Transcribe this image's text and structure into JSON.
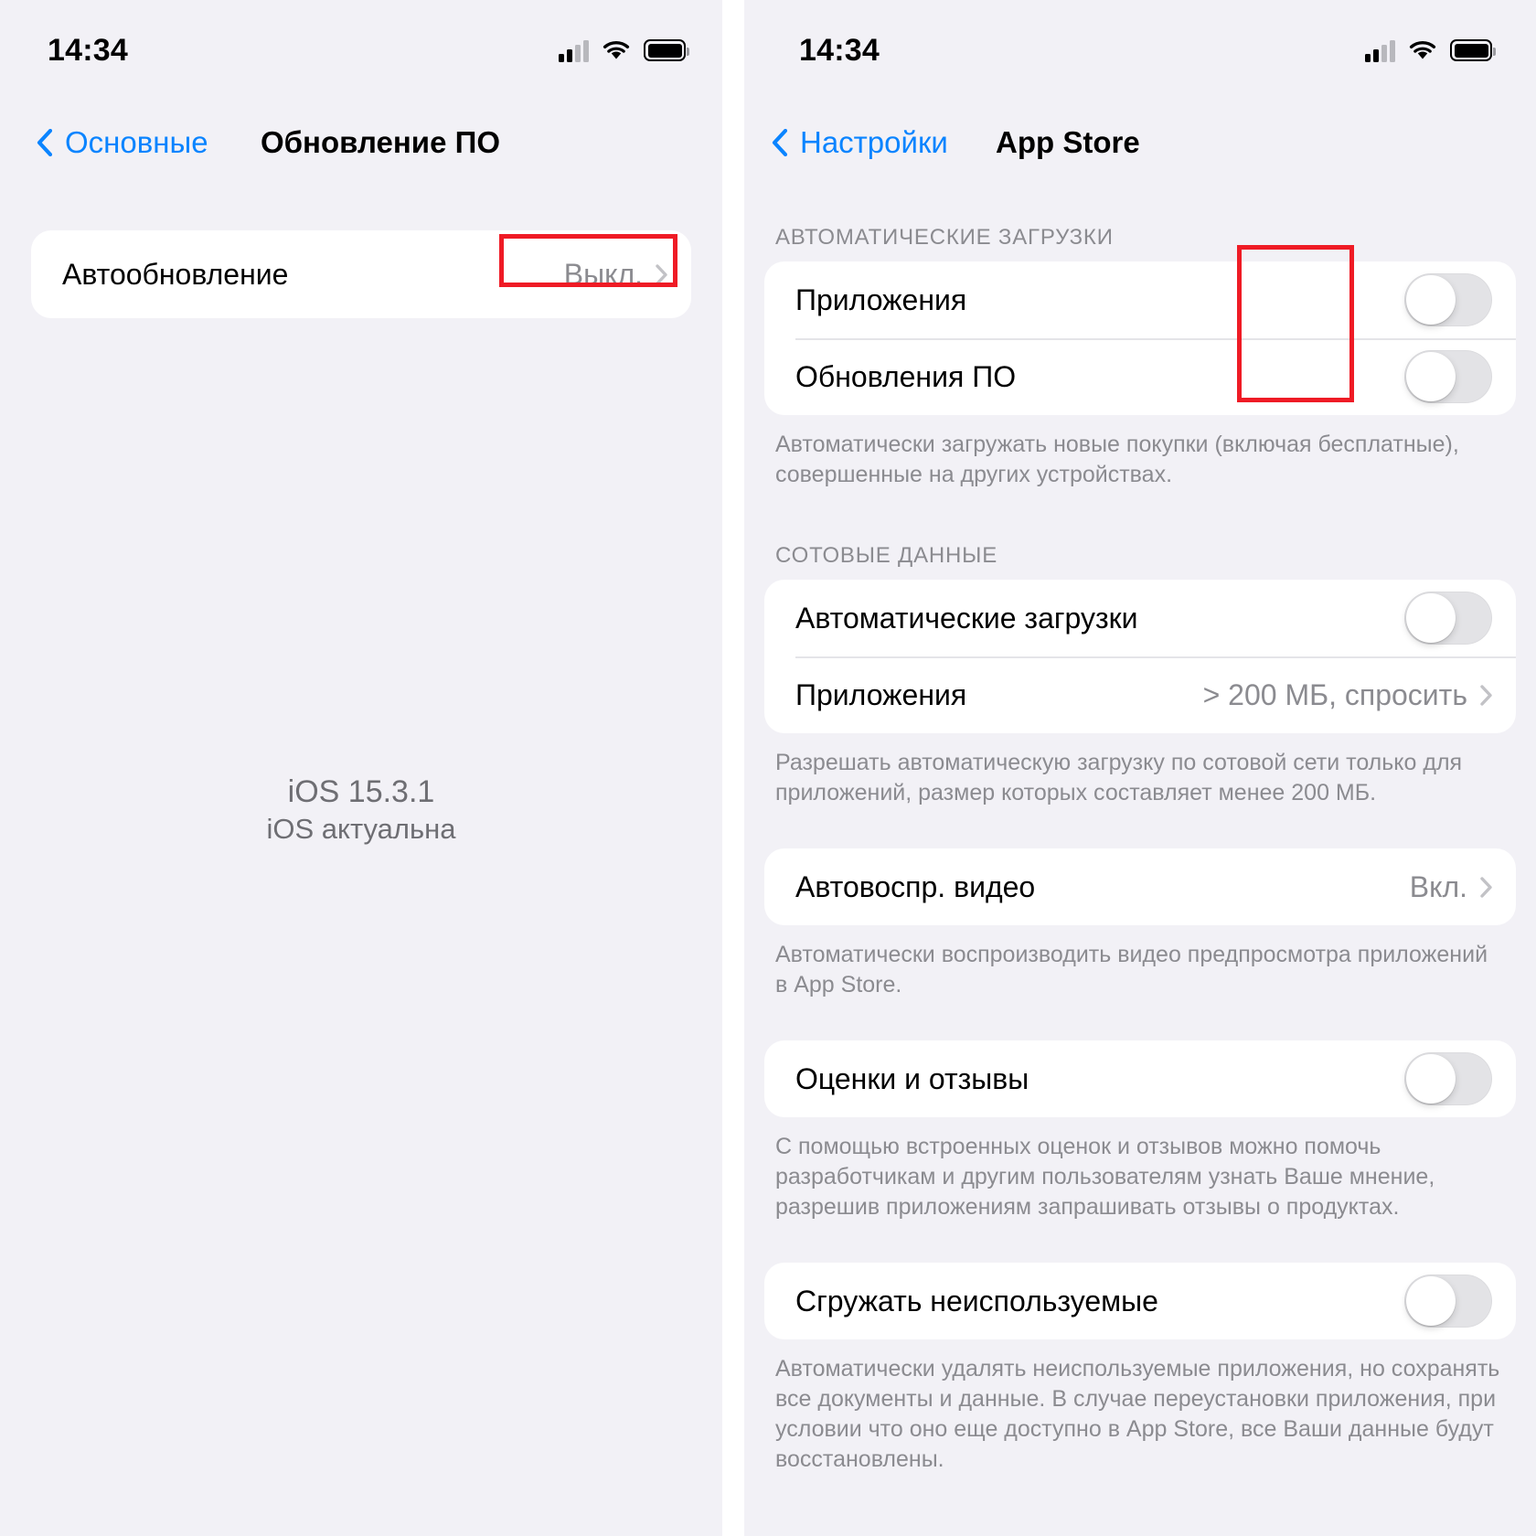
{
  "left_screen": {
    "status_bar": {
      "time": "14:34",
      "cellular_icon": "cellular-signal-icon",
      "wifi_icon": "wifi-icon",
      "battery_icon": "battery-full-icon"
    },
    "nav": {
      "back_label": "Основные",
      "back_icon": "chevron-left-icon",
      "title": "Обновление ПО"
    },
    "rows": [
      {
        "label": "Автообновление",
        "value": "Выкл.",
        "chevron_icon": "chevron-right-icon",
        "highlighted": true
      }
    ],
    "version": {
      "line1": "iOS 15.3.1",
      "line2": "iOS актуальна"
    }
  },
  "right_screen": {
    "status_bar": {
      "time": "14:34",
      "cellular_icon": "cellular-signal-icon",
      "wifi_icon": "wifi-icon",
      "battery_icon": "battery-full-icon"
    },
    "nav": {
      "back_label": "Настройки",
      "back_icon": "chevron-left-icon",
      "title": "App Store"
    },
    "sections": [
      {
        "header": "АВТОМАТИЧЕСКИЕ ЗАГРУЗКИ",
        "rows": [
          {
            "label": "Приложения",
            "control": "toggle",
            "state": "off"
          },
          {
            "label": "Обновления ПО",
            "control": "toggle",
            "state": "off"
          }
        ],
        "footnote": "Автоматически загружать новые покупки (включая бесплатные), совершенные на других устройствах."
      },
      {
        "header": "СОТОВЫЕ ДАННЫЕ",
        "rows": [
          {
            "label": "Автоматические загрузки",
            "control": "toggle",
            "state": "off"
          },
          {
            "label": "Приложения",
            "control": "value",
            "value": "> 200 МБ, спросить",
            "chevron_icon": "chevron-right-icon"
          }
        ],
        "footnote": "Разрешать автоматическую загрузку по сотовой сети только для приложений, размер которых составляет менее 200 МБ."
      },
      {
        "header": "",
        "rows": [
          {
            "label": "Автовоспр. видео",
            "control": "value",
            "value": "Вкл.",
            "chevron_icon": "chevron-right-icon"
          }
        ],
        "footnote": "Автоматически воспроизводить видео предпросмотра приложений в App Store."
      },
      {
        "header": "",
        "rows": [
          {
            "label": "Оценки и отзывы",
            "control": "toggle",
            "state": "off"
          }
        ],
        "footnote": "С помощью встроенных оценок и отзывов можно помочь разработчикам и другим пользователям узнать Ваше мнение, разрешив приложениям запрашивать отзывы о продуктах."
      },
      {
        "header": "",
        "rows": [
          {
            "label": "Сгружать неиспользуемые",
            "control": "toggle",
            "state": "off"
          }
        ],
        "footnote": "Автоматически удалять неиспользуемые приложения, но сохранять все документы и данные. В случае переустановки приложения, при условии что оно еще доступно в App Store, все Ваши данные будут восстановлены."
      }
    ]
  },
  "annotations": {
    "highlight_color": "#ef1b25",
    "accent_color": "#0a84ff",
    "background_color": "#f2f1f6",
    "card_color": "#ffffff",
    "secondary_text_color": "#8b8b90"
  }
}
